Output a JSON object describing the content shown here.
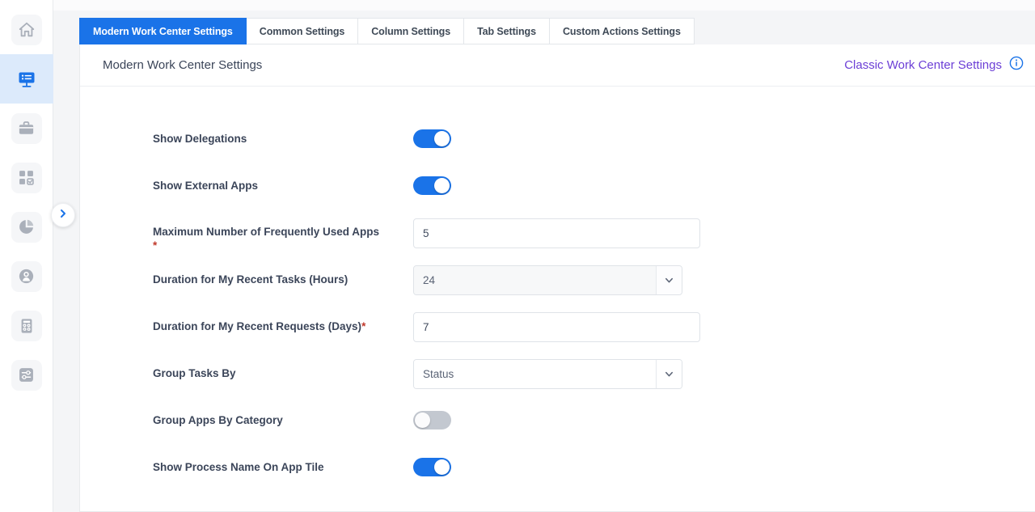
{
  "sidebar": {
    "items": [
      {
        "name": "home",
        "icon": "home-icon",
        "active": false
      },
      {
        "name": "workcenter",
        "icon": "monitor-list-icon",
        "active": true
      },
      {
        "name": "briefcase",
        "icon": "briefcase-icon",
        "active": false
      },
      {
        "name": "apps",
        "icon": "grid-check-icon",
        "active": false
      },
      {
        "name": "reports",
        "icon": "pie-chart-icon",
        "active": false
      },
      {
        "name": "users",
        "icon": "user-circle-icon",
        "active": false
      },
      {
        "name": "calculator",
        "icon": "calculator-icon",
        "active": false
      },
      {
        "name": "settings",
        "icon": "sliders-icon",
        "active": false
      }
    ],
    "expand_icon": "chevron-right-icon"
  },
  "tabs": [
    {
      "label": "Modern Work Center Settings",
      "active": true
    },
    {
      "label": "Common Settings",
      "active": false
    },
    {
      "label": "Column Settings",
      "active": false
    },
    {
      "label": "Tab Settings",
      "active": false
    },
    {
      "label": "Custom Actions Settings",
      "active": false
    }
  ],
  "header": {
    "title": "Modern Work Center Settings",
    "classic_link": "Classic Work Center Settings",
    "info_icon": "info-circle-icon"
  },
  "form": {
    "rows": [
      {
        "label": "Show Delegations",
        "type": "toggle",
        "value": "on",
        "required": false,
        "name": "show-delegations"
      },
      {
        "label": "Show External Apps",
        "type": "toggle",
        "value": "on",
        "required": false,
        "name": "show-external-apps"
      },
      {
        "label": "Maximum Number of Frequently Used Apps",
        "type": "text",
        "value": "5",
        "required": true,
        "required_on_new_line": true,
        "name": "max-frequently-used-apps"
      },
      {
        "label": "Duration for My Recent Tasks (Hours)",
        "type": "select",
        "value": "24",
        "required": false,
        "muted": true,
        "name": "duration-recent-tasks"
      },
      {
        "label": "Duration for My Recent Requests (Days)",
        "type": "text",
        "value": "7",
        "required": true,
        "required_on_new_line": false,
        "name": "duration-recent-requests"
      },
      {
        "label": "Group Tasks By",
        "type": "select",
        "value": "Status",
        "required": false,
        "muted": false,
        "name": "group-tasks-by"
      },
      {
        "label": "Group Apps By Category",
        "type": "toggle",
        "value": "off",
        "required": false,
        "name": "group-apps-by-category"
      },
      {
        "label": "Show Process Name On App Tile",
        "type": "toggle",
        "value": "on",
        "required": false,
        "name": "show-process-name-on-app-tile"
      }
    ]
  },
  "colors": {
    "accent_blue": "#1a73e8",
    "link_purple": "#6c3fd6",
    "required_red": "#c0392b",
    "toggle_off": "#c3c8d0",
    "active_rail_bg": "#dceafb",
    "text_dark": "#3b4559"
  }
}
